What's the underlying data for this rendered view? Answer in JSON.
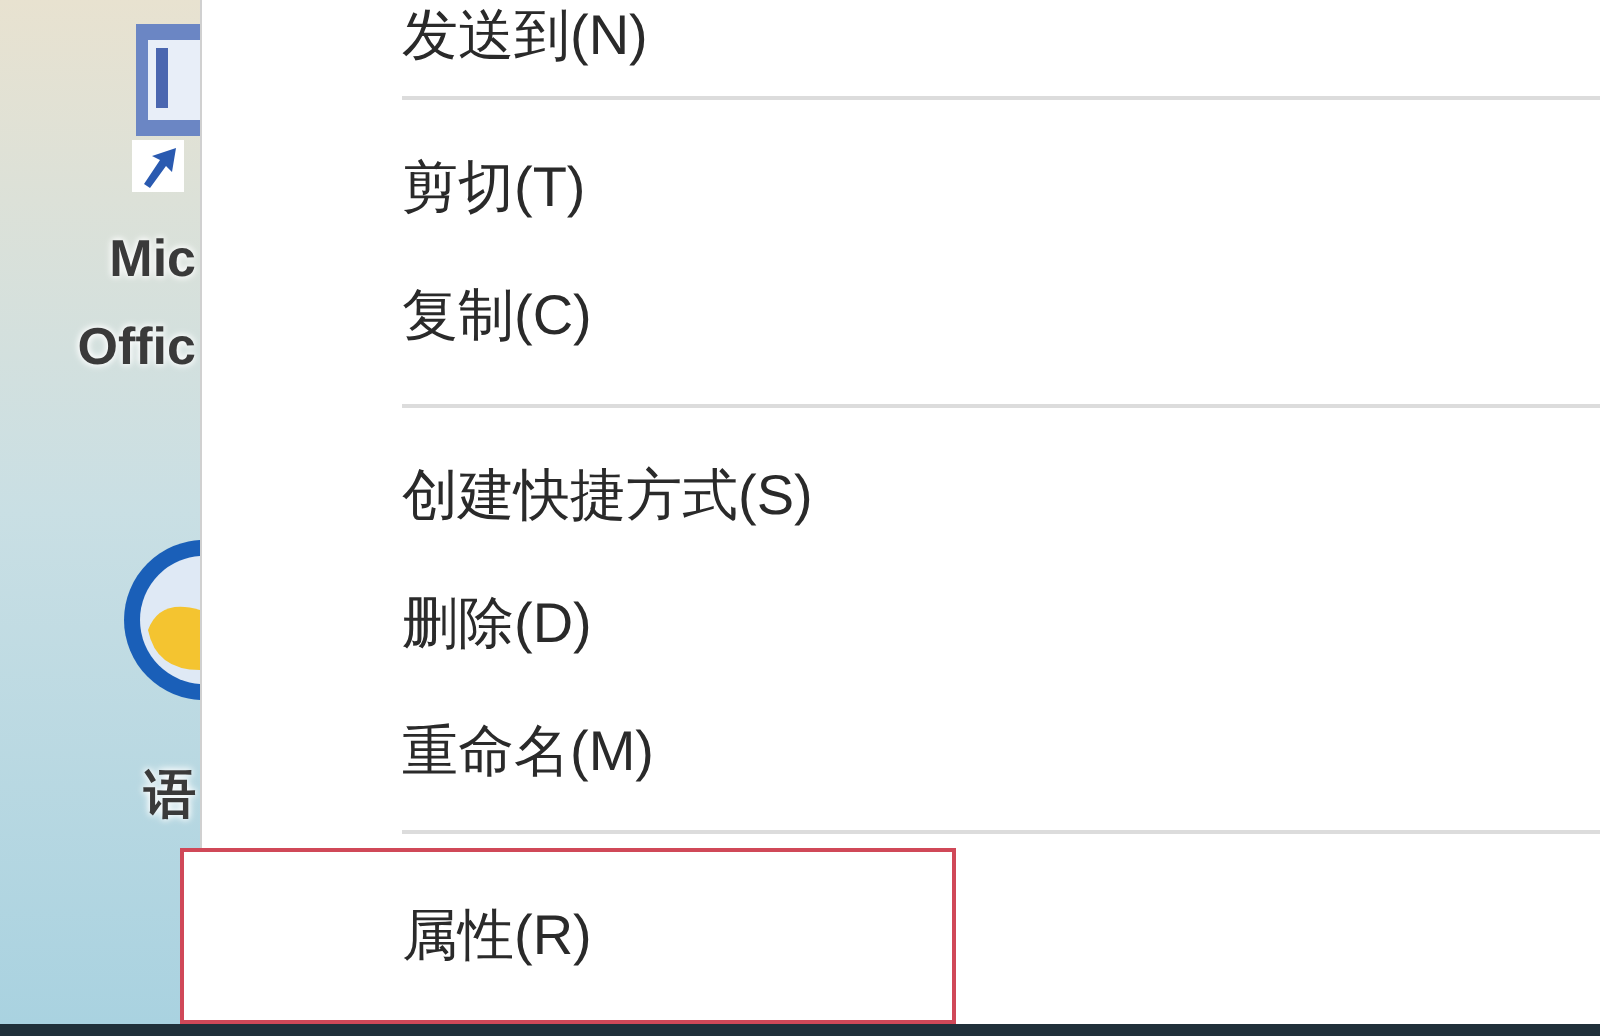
{
  "desktop": {
    "icons": [
      {
        "kind": "shortcut",
        "label_lines": [
          "Mic",
          "Offic"
        ]
      },
      {
        "kind": "app",
        "label_lines": [
          "语"
        ]
      }
    ]
  },
  "context_menu": {
    "items": [
      {
        "kind": "item",
        "label": "发送到(N)",
        "selected": false
      },
      {
        "kind": "separator"
      },
      {
        "kind": "item",
        "label": "剪切(T)",
        "selected": false
      },
      {
        "kind": "item",
        "label": "复制(C)",
        "selected": false
      },
      {
        "kind": "separator"
      },
      {
        "kind": "item",
        "label": "创建快捷方式(S)",
        "selected": false
      },
      {
        "kind": "item",
        "label": "删除(D)",
        "selected": false
      },
      {
        "kind": "item",
        "label": "重命名(M)",
        "selected": false
      },
      {
        "kind": "separator"
      },
      {
        "kind": "item",
        "label": "属性(R)",
        "selected": true
      }
    ]
  }
}
